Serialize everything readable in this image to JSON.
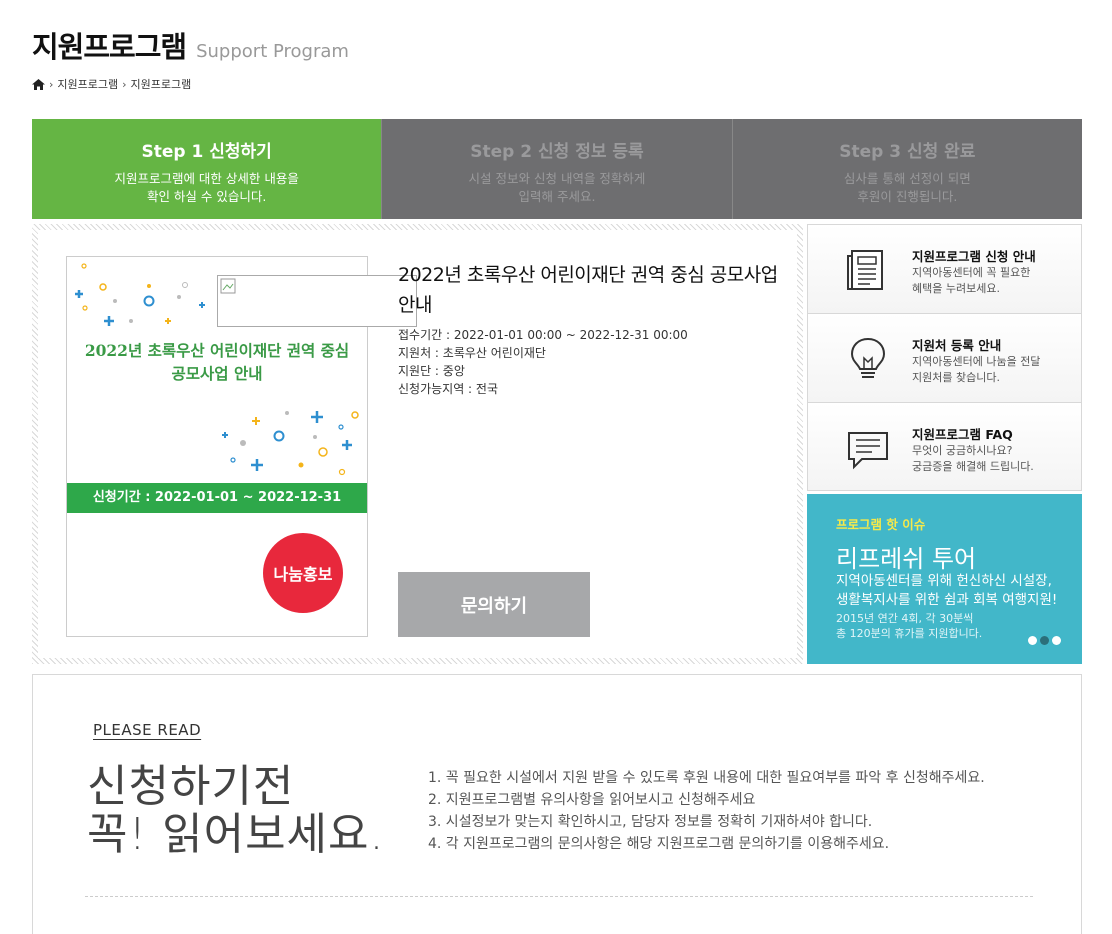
{
  "header": {
    "title_ko": "지원프로그램",
    "title_en": "Support Program",
    "breadcrumb": [
      "지원프로그램",
      "지원프로그램"
    ]
  },
  "steps": [
    {
      "title": "Step 1 신청하기",
      "desc1": "지원프로그램에 대한 상세한 내용을",
      "desc2": "확인 하실 수 있습니다.",
      "active": true
    },
    {
      "title": "Step 2 신청 정보 등록",
      "desc1": "시설 정보와 신청 내역을 정확하게",
      "desc2": "입력해 주세요.",
      "active": false
    },
    {
      "title": "Step 3 신청 완료",
      "desc1": "심사를 통해 선정이 되면",
      "desc2": "후원이 진행됩니다.",
      "active": false
    }
  ],
  "poster": {
    "title": "2022년 초록우산 어린이재단 권역 중심 공모사업 안내",
    "period": "신청기간 : 2022-01-01 ~ 2022-12-31",
    "badge": "나눔홍보"
  },
  "program": {
    "title": "2022년 초록우산 어린이재단 권역 중심 공모사업 안내",
    "period": "접수기간 : 2022-01-01 00:00 ~ 2022-12-31 00:00",
    "org": "지원처 : 초록우산 어린이재단",
    "group": "지원단 : 중앙",
    "region": "신청가능지역 : 전국",
    "inquiry_label": "문의하기"
  },
  "side": [
    {
      "title": "지원프로그램 신청 안내",
      "desc1": "지역아동센터에 꼭 필요한",
      "desc2": "혜택을 누려보세요.",
      "icon": "document-icon"
    },
    {
      "title": "지원처 등록 안내",
      "desc1": "지역아동센터에 나눔을 전달",
      "desc2": "지원처를 찾습니다.",
      "icon": "lightbulb-icon"
    },
    {
      "title": "지원프로그램 FAQ",
      "desc1": "무엇이 궁금하시나요?",
      "desc2": "궁금증을 해결해 드립니다.",
      "icon": "chat-icon"
    }
  ],
  "hot": {
    "label": "프로그램 핫 이슈",
    "title": "리프레쉬 투어",
    "body1": "지역아동센터를 위해 헌신하신 시설장,",
    "body2": "생활복지사를 위한 쉼과 회복 여행지원!",
    "sub1": "2015년 연간 4회, 각 30분씩",
    "sub2": "총 120분의 휴가를 지원합니다."
  },
  "read": {
    "please": "PLEASE READ",
    "big1": "신청하기전",
    "big2": "꼭! 읽어보세요.",
    "items": [
      "1. 꼭 필요한 시설에서 지원 받을 수 있도록 후원 내용에 대한 필요여부를 파악 후 신청해주세요.",
      "2. 지원프로그램별 유의사항을 읽어보시고 신청해주세요",
      "3. 시설정보가 맞는지 확인하시고, 담당자 정보를 정확히 기재하셔야 합니다.",
      "4. 각 지원프로그램의 문의사항은 해당 지원프로그램 문의하기를 이용해주세요."
    ]
  }
}
